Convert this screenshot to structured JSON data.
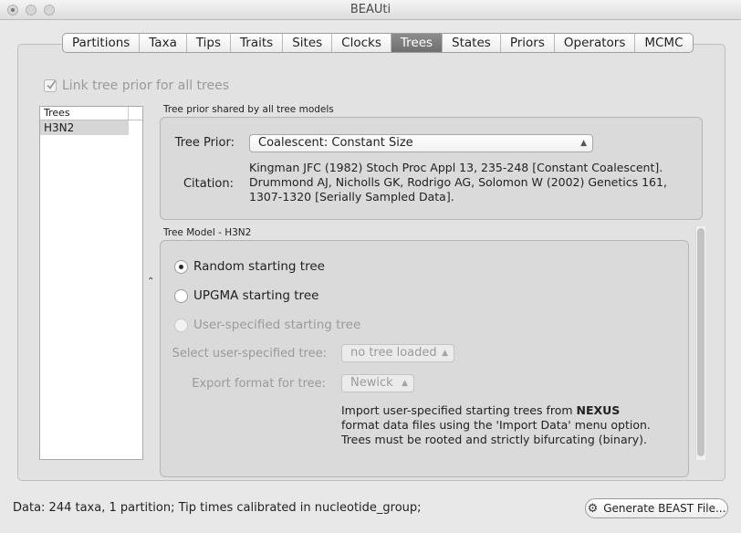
{
  "window": {
    "title": "BEAUti"
  },
  "tabs": [
    {
      "label": "Partitions"
    },
    {
      "label": "Taxa"
    },
    {
      "label": "Tips"
    },
    {
      "label": "Traits"
    },
    {
      "label": "Sites"
    },
    {
      "label": "Clocks"
    },
    {
      "label": "Trees",
      "active": true
    },
    {
      "label": "States"
    },
    {
      "label": "Priors"
    },
    {
      "label": "Operators"
    },
    {
      "label": "MCMC"
    }
  ],
  "link_checkbox": {
    "label": "Link tree prior for all trees",
    "checked": true,
    "enabled": false
  },
  "trees_list": {
    "header": "Trees",
    "items": [
      "H3N2"
    ],
    "selected": "H3N2"
  },
  "tree_prior": {
    "group_title": "Tree prior shared by all tree models",
    "prior_label": "Tree Prior:",
    "prior_value": "Coalescent: Constant Size",
    "citation_label": "Citation:",
    "citation_lines": [
      "Kingman JFC (1982) Stoch Proc Appl 13, 235-248 [Constant Coalescent].",
      "Drummond AJ, Nicholls GK, Rodrigo AG, Solomon W (2002) Genetics 161,",
      "1307-1320 [Serially Sampled Data]."
    ]
  },
  "tree_model": {
    "group_title": "Tree Model - H3N2",
    "options": [
      {
        "label": "Random starting tree",
        "selected": true,
        "enabled": true
      },
      {
        "label": "UPGMA starting tree",
        "selected": false,
        "enabled": true
      },
      {
        "label": "User-specified starting tree",
        "selected": false,
        "enabled": false
      }
    ],
    "select_tree_label": "Select user-specified tree:",
    "select_tree_value": "no tree loaded",
    "export_format_label": "Export format for tree:",
    "export_format_value": "Newick",
    "info_prefix": "Import user-specified starting trees from ",
    "info_bold": "NEXUS",
    "info_line2": "format data files using the 'Import Data' menu option.",
    "info_line3": "Trees must be rooted and strictly bifurcating (binary)."
  },
  "status_bar": {
    "text": "Data: 244 taxa, 1 partition; Tip times calibrated in nucleotide_group;",
    "generate_button": "Generate BEAST File..."
  },
  "icons": {
    "gear": "gear-icon",
    "check": "checkmark-icon",
    "collapse": "collapse-arrow-icon"
  }
}
